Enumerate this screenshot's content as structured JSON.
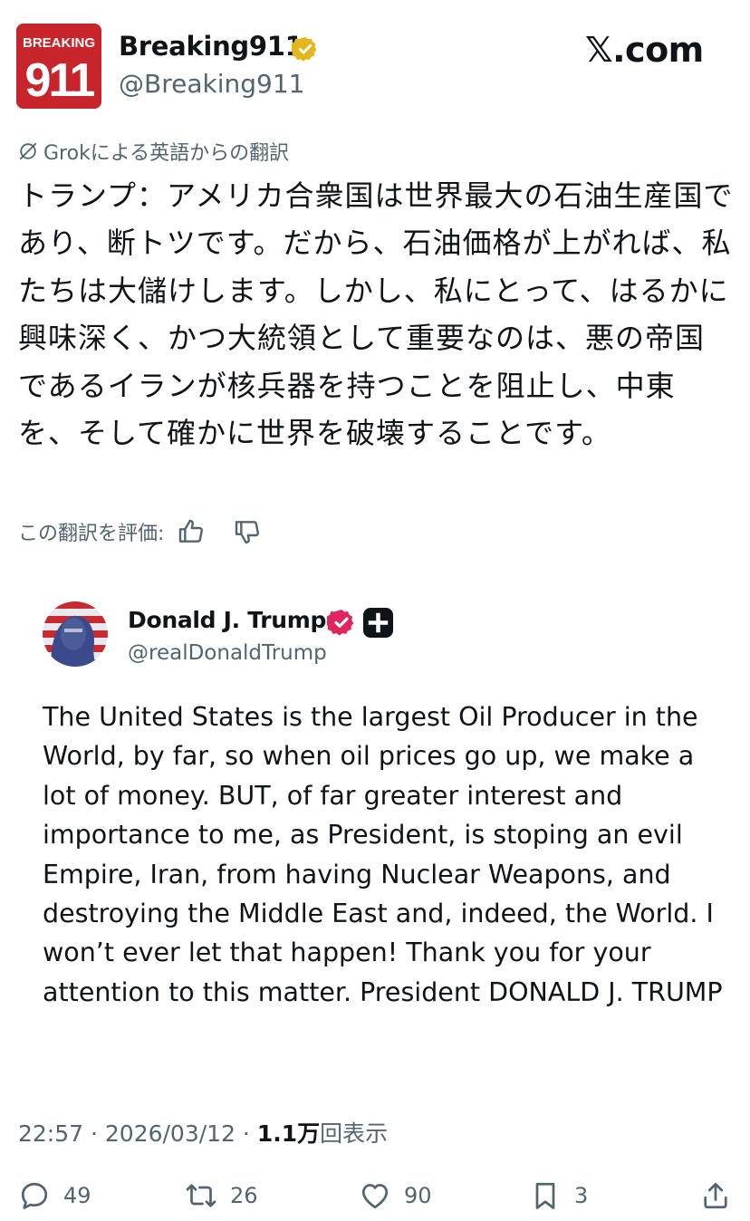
{
  "post": {
    "avatar_text_top": "BREAKING",
    "avatar_text_big": "911",
    "author_name": "Breaking911",
    "author_handle": "@Breaking911",
    "site_label": "𝕏.com"
  },
  "translation": {
    "header": "Grokによる英語からの翻訳",
    "text": "トランプ：アメリカ合衆国は世界最大の石油生産国であり、断トツです。だから、石油価格が上がれば、私たちは大儲けします。しかし、私にとって、はるかに興味深く、かつ大統領として重要なのは、悪の帝国であるイランが核兵器を持つことを阻止し、中東を、そして確かに世界を破壊することです。",
    "rate_label": "この翻訳を評価:"
  },
  "quote": {
    "author_name": "Donald J. Trump",
    "author_handle": "@realDonaldTrump",
    "body": "The United States is the largest Oil Producer in the World, by far, so when oil prices go up, we make a lot of money. BUT, of far greater interest and importance to me, as President, is stoping an evil Empire, Iran, from having Nuclear Weapons, and destroying the Middle East and, indeed, the World. I won’t ever let that happen! Thank you for your attention to this matter. President DONALD J. TRUMP"
  },
  "meta": {
    "time": "22:57",
    "date": "2026/03/12",
    "views_count": "1.1万",
    "views_label": "回表示",
    "separator": " · "
  },
  "actions": {
    "replies": "49",
    "reposts": "26",
    "likes": "90",
    "bookmarks": "3"
  },
  "colors": {
    "text": "#0f1419",
    "secondary": "#536471",
    "brand_red": "#c8242b",
    "verified_gold": "#e2b719",
    "verified_pink": "#e0245e"
  }
}
